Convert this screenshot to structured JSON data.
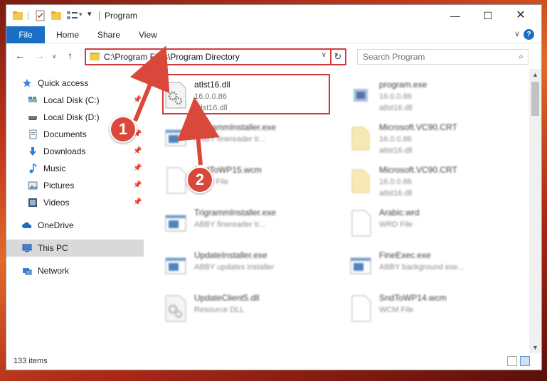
{
  "window": {
    "title": "Program"
  },
  "ribbon": {
    "tabs": [
      "File",
      "Home",
      "Share",
      "View"
    ]
  },
  "address": {
    "path": "C:\\Program Files\\Program Directory"
  },
  "search": {
    "placeholder": "Search Program"
  },
  "nav": {
    "items": [
      {
        "label": "Quick access",
        "icon": "star-icon",
        "pinned": false
      },
      {
        "label": "Local Disk (C:)",
        "icon": "drive-icon",
        "pinned": true
      },
      {
        "label": "Local Disk (D:)",
        "icon": "drive-icon",
        "pinned": true
      },
      {
        "label": "Documents",
        "icon": "documents-icon",
        "pinned": true
      },
      {
        "label": "Downloads",
        "icon": "download-icon",
        "pinned": true
      },
      {
        "label": "Music",
        "icon": "music-icon",
        "pinned": true
      },
      {
        "label": "Pictures",
        "icon": "pictures-icon",
        "pinned": true
      },
      {
        "label": "Videos",
        "icon": "videos-icon",
        "pinned": true
      },
      {
        "label": "OneDrive",
        "icon": "cloud-icon",
        "pinned": false
      },
      {
        "label": "This PC",
        "icon": "computer-icon",
        "pinned": false,
        "selected": true
      },
      {
        "label": "Network",
        "icon": "network-icon",
        "pinned": false
      }
    ]
  },
  "files": [
    {
      "name": "atlst16.dll",
      "sub1": "16.0.0.86",
      "sub2": "atlst16.dll",
      "icon": "dll-gear-icon",
      "highlighted": true
    },
    {
      "name": "program.exe",
      "sub1": "16.0.0.86",
      "sub2": "atlst16.dll",
      "icon": "exe-icon"
    },
    {
      "name": "TrigrammInstaller.exe",
      "sub1": "ABBY finereader tr...",
      "sub2": "",
      "icon": "window-icon"
    },
    {
      "name": "Microsoft.VC90.CRT",
      "sub1": "16.0.0.86",
      "sub2": "atlst16.dll",
      "icon": "folder-icon"
    },
    {
      "name": "SndToWP15.wcm",
      "sub1": "WCM File",
      "sub2": "",
      "icon": "blank-file-icon"
    },
    {
      "name": "Microsoft.VC90.CRT",
      "sub1": "16.0.0.86",
      "sub2": "atlst16.dll",
      "icon": "folder-icon"
    },
    {
      "name": "TrigrammInstaller.exe",
      "sub1": "ABBY finereader tr...",
      "sub2": "",
      "icon": "window-icon"
    },
    {
      "name": "Arabic.wrd",
      "sub1": "WRD File",
      "sub2": "",
      "icon": "blank-file-icon"
    },
    {
      "name": "UpdateInstaller.exe",
      "sub1": "ABBY updates installer",
      "sub2": "",
      "icon": "window-icon"
    },
    {
      "name": "FineExec.exe",
      "sub1": "ABBY background exe...",
      "sub2": "",
      "icon": "window-icon"
    },
    {
      "name": "UpdateClient5.dll",
      "sub1": "Resource DLL",
      "sub2": "",
      "icon": "dll-gear-icon"
    },
    {
      "name": "SndToWP14.wcm",
      "sub1": "WCM File",
      "sub2": "",
      "icon": "blank-file-icon"
    }
  ],
  "status": {
    "item_count": "133 items"
  },
  "callouts": {
    "one": "1",
    "two": "2"
  },
  "colors": {
    "accent": "#1a6fc4",
    "highlight_border": "#d43a3a",
    "callout": "#d9483b",
    "selected_nav": "#d9d9d9"
  }
}
